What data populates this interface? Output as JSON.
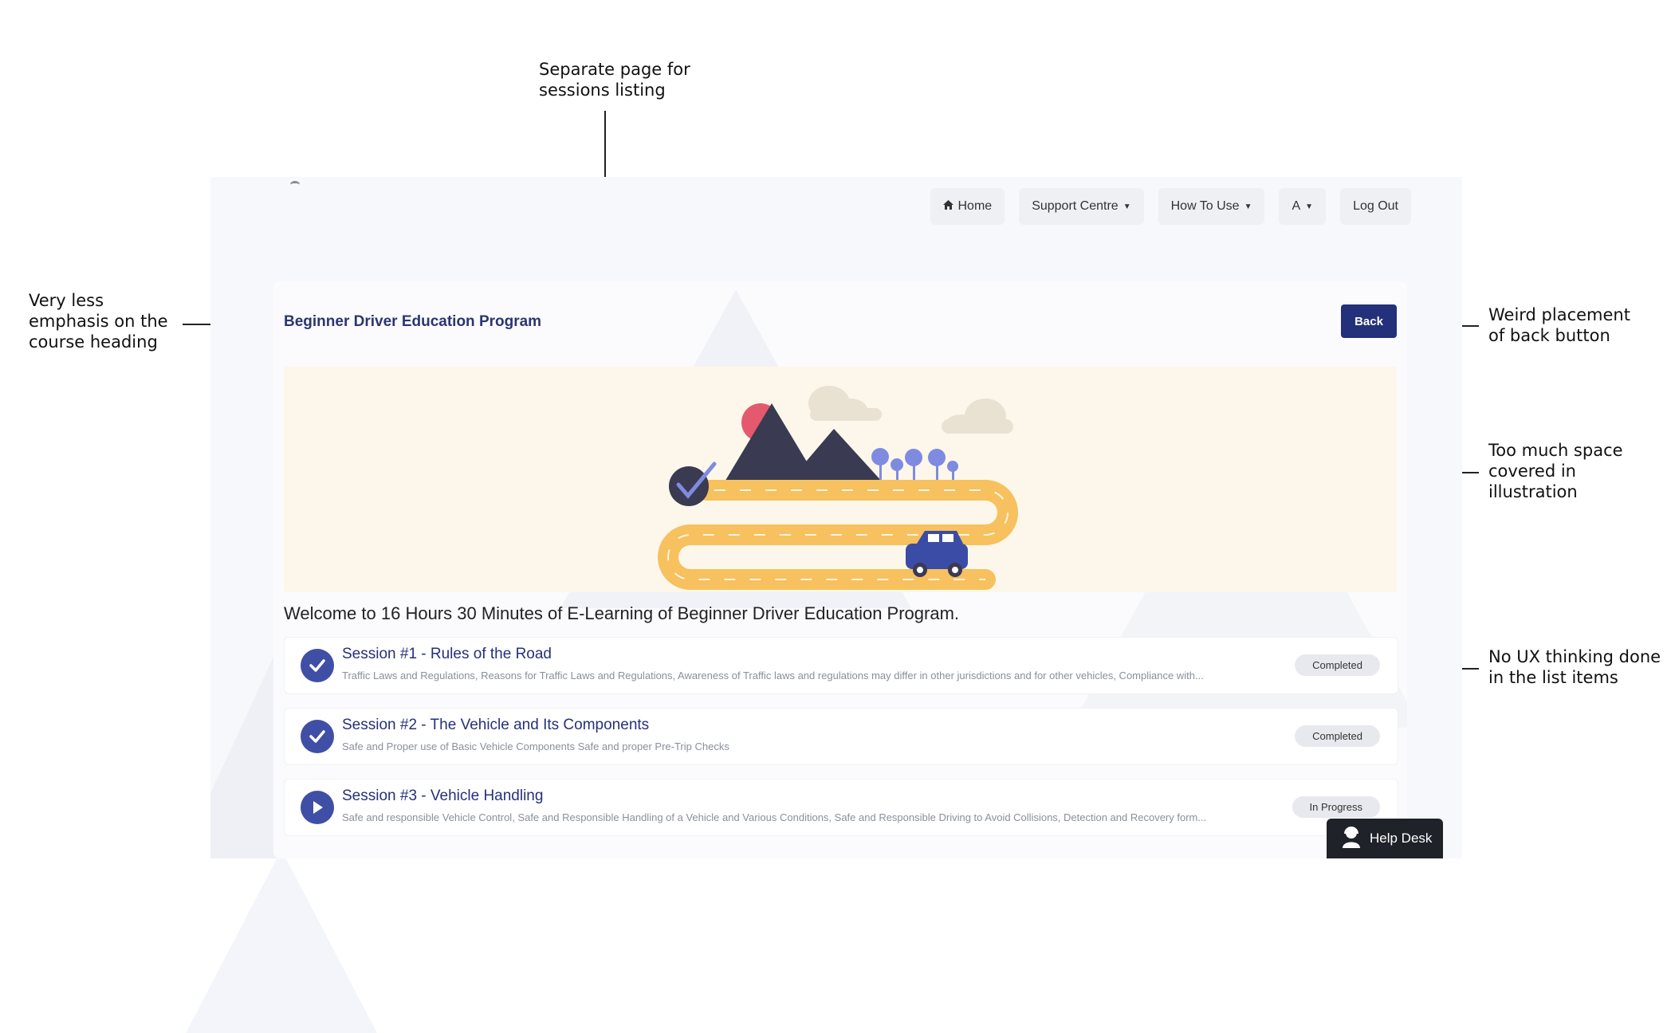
{
  "annotations": {
    "sessions_page": "Separate page for\nsessions listing",
    "heading_emphasis": "Very less\nemphasis on the\ncourse heading",
    "back_button": "Weird placement\nof back button",
    "illustration_space": "Too much space\ncovered in\nillustration",
    "list_items": "No UX thinking done\nin the list items"
  },
  "nav": {
    "home": "Home",
    "support": "Support Centre",
    "how_to_use": "How To Use",
    "account": "A",
    "logout": "Log Out"
  },
  "course": {
    "title": "Beginner Driver Education Program",
    "back_label": "Back",
    "welcome": "Welcome to 16 Hours 30 Minutes of E-Learning of Beginner Driver Education Program."
  },
  "sessions": [
    {
      "title": "Session #1 - Rules of the Road",
      "description": "Traffic Laws and Regulations, Reasons for Traffic Laws and Regulations, Awareness of Traffic laws and regulations may differ in other jurisdictions and for other vehicles, Compliance with...",
      "status": "Completed",
      "icon": "check-icon"
    },
    {
      "title": "Session #2 - The Vehicle and Its Components",
      "description": "Safe and Proper use of Basic Vehicle Components Safe and proper Pre-Trip Checks",
      "status": "Completed",
      "icon": "check-icon"
    },
    {
      "title": "Session #3 - Vehicle Handling",
      "description": "Safe and responsible Vehicle Control, Safe and Responsible Handling of a Vehicle and Various Conditions, Safe and Responsible Driving to Avoid Collisions, Detection and Recovery form...",
      "status": "In Progress",
      "icon": "play-icon"
    }
  ],
  "help_desk": {
    "label": "Help Desk"
  },
  "colors": {
    "primary": "#23307a",
    "accent_icon": "#3f4fa6",
    "banner_bg": "#fcf7ea",
    "road": "#f6c15e",
    "car": "#3b4ca6"
  }
}
